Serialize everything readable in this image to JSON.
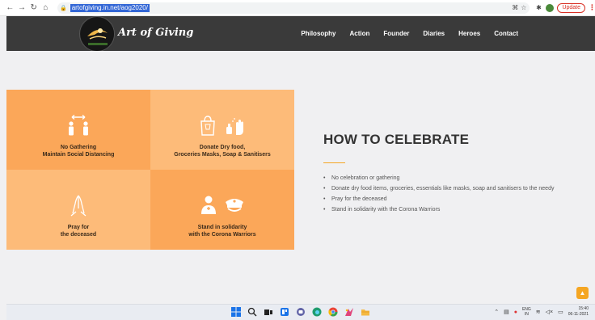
{
  "browser": {
    "url": "artofgiving.in.net/aog2020/",
    "update_label": "Update",
    "menu_glyph": "⋮"
  },
  "site": {
    "brand": "Art of Giving",
    "nav": [
      "Philosophy",
      "Action",
      "Founder",
      "Diaries",
      "Heroes",
      "Contact"
    ]
  },
  "tiles": [
    {
      "line1": "No Gathering",
      "line2": "Maintain Social Distancing",
      "icon": "social-distance-icon"
    },
    {
      "line1": "Donate  Dry food,",
      "line2": "Groceries Masks, Soap & Sanitisers",
      "icon": "donation-icon"
    },
    {
      "line1": "Pray for",
      "line2": "the deceased",
      "icon": "pray-icon"
    },
    {
      "line1": "Stand in solidarity",
      "line2": "with the Corona Warriors",
      "icon": "warriors-icon"
    }
  ],
  "celebrate": {
    "title": "HOW TO CELEBRATE",
    "bullets": [
      "No celebration or gathering",
      "Donate dry food items, groceries, essentials like masks, soap and sanitisers to the needy",
      "Pray for the deceased",
      "Stand in solidarity with the Corona Warriors"
    ]
  },
  "taskbar": {
    "lang_line1": "ENG",
    "lang_line2": "IN",
    "time": "15:40",
    "date": "06-11-2021"
  },
  "colors": {
    "header_bg": "#3a3a3a",
    "tile_dark": "#fba759",
    "tile_light": "#fdbb79",
    "accent": "#f5a623"
  }
}
